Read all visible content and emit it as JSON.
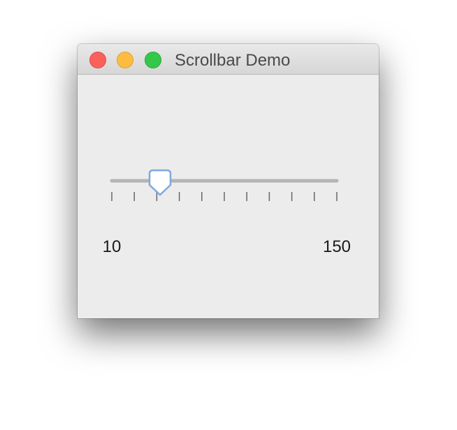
{
  "window": {
    "title": "Scrollbar Demo"
  },
  "slider": {
    "min": 10,
    "max": 150,
    "value": 40,
    "major_tick_spacing": 140,
    "tick_count": 11,
    "labels": {
      "min_label": "10",
      "max_label": "150"
    }
  },
  "colors": {
    "track": "#b4b4b4",
    "thumb_border": "#7fa8e0",
    "thumb_fill": "#ffffff",
    "tick": "#666666"
  }
}
